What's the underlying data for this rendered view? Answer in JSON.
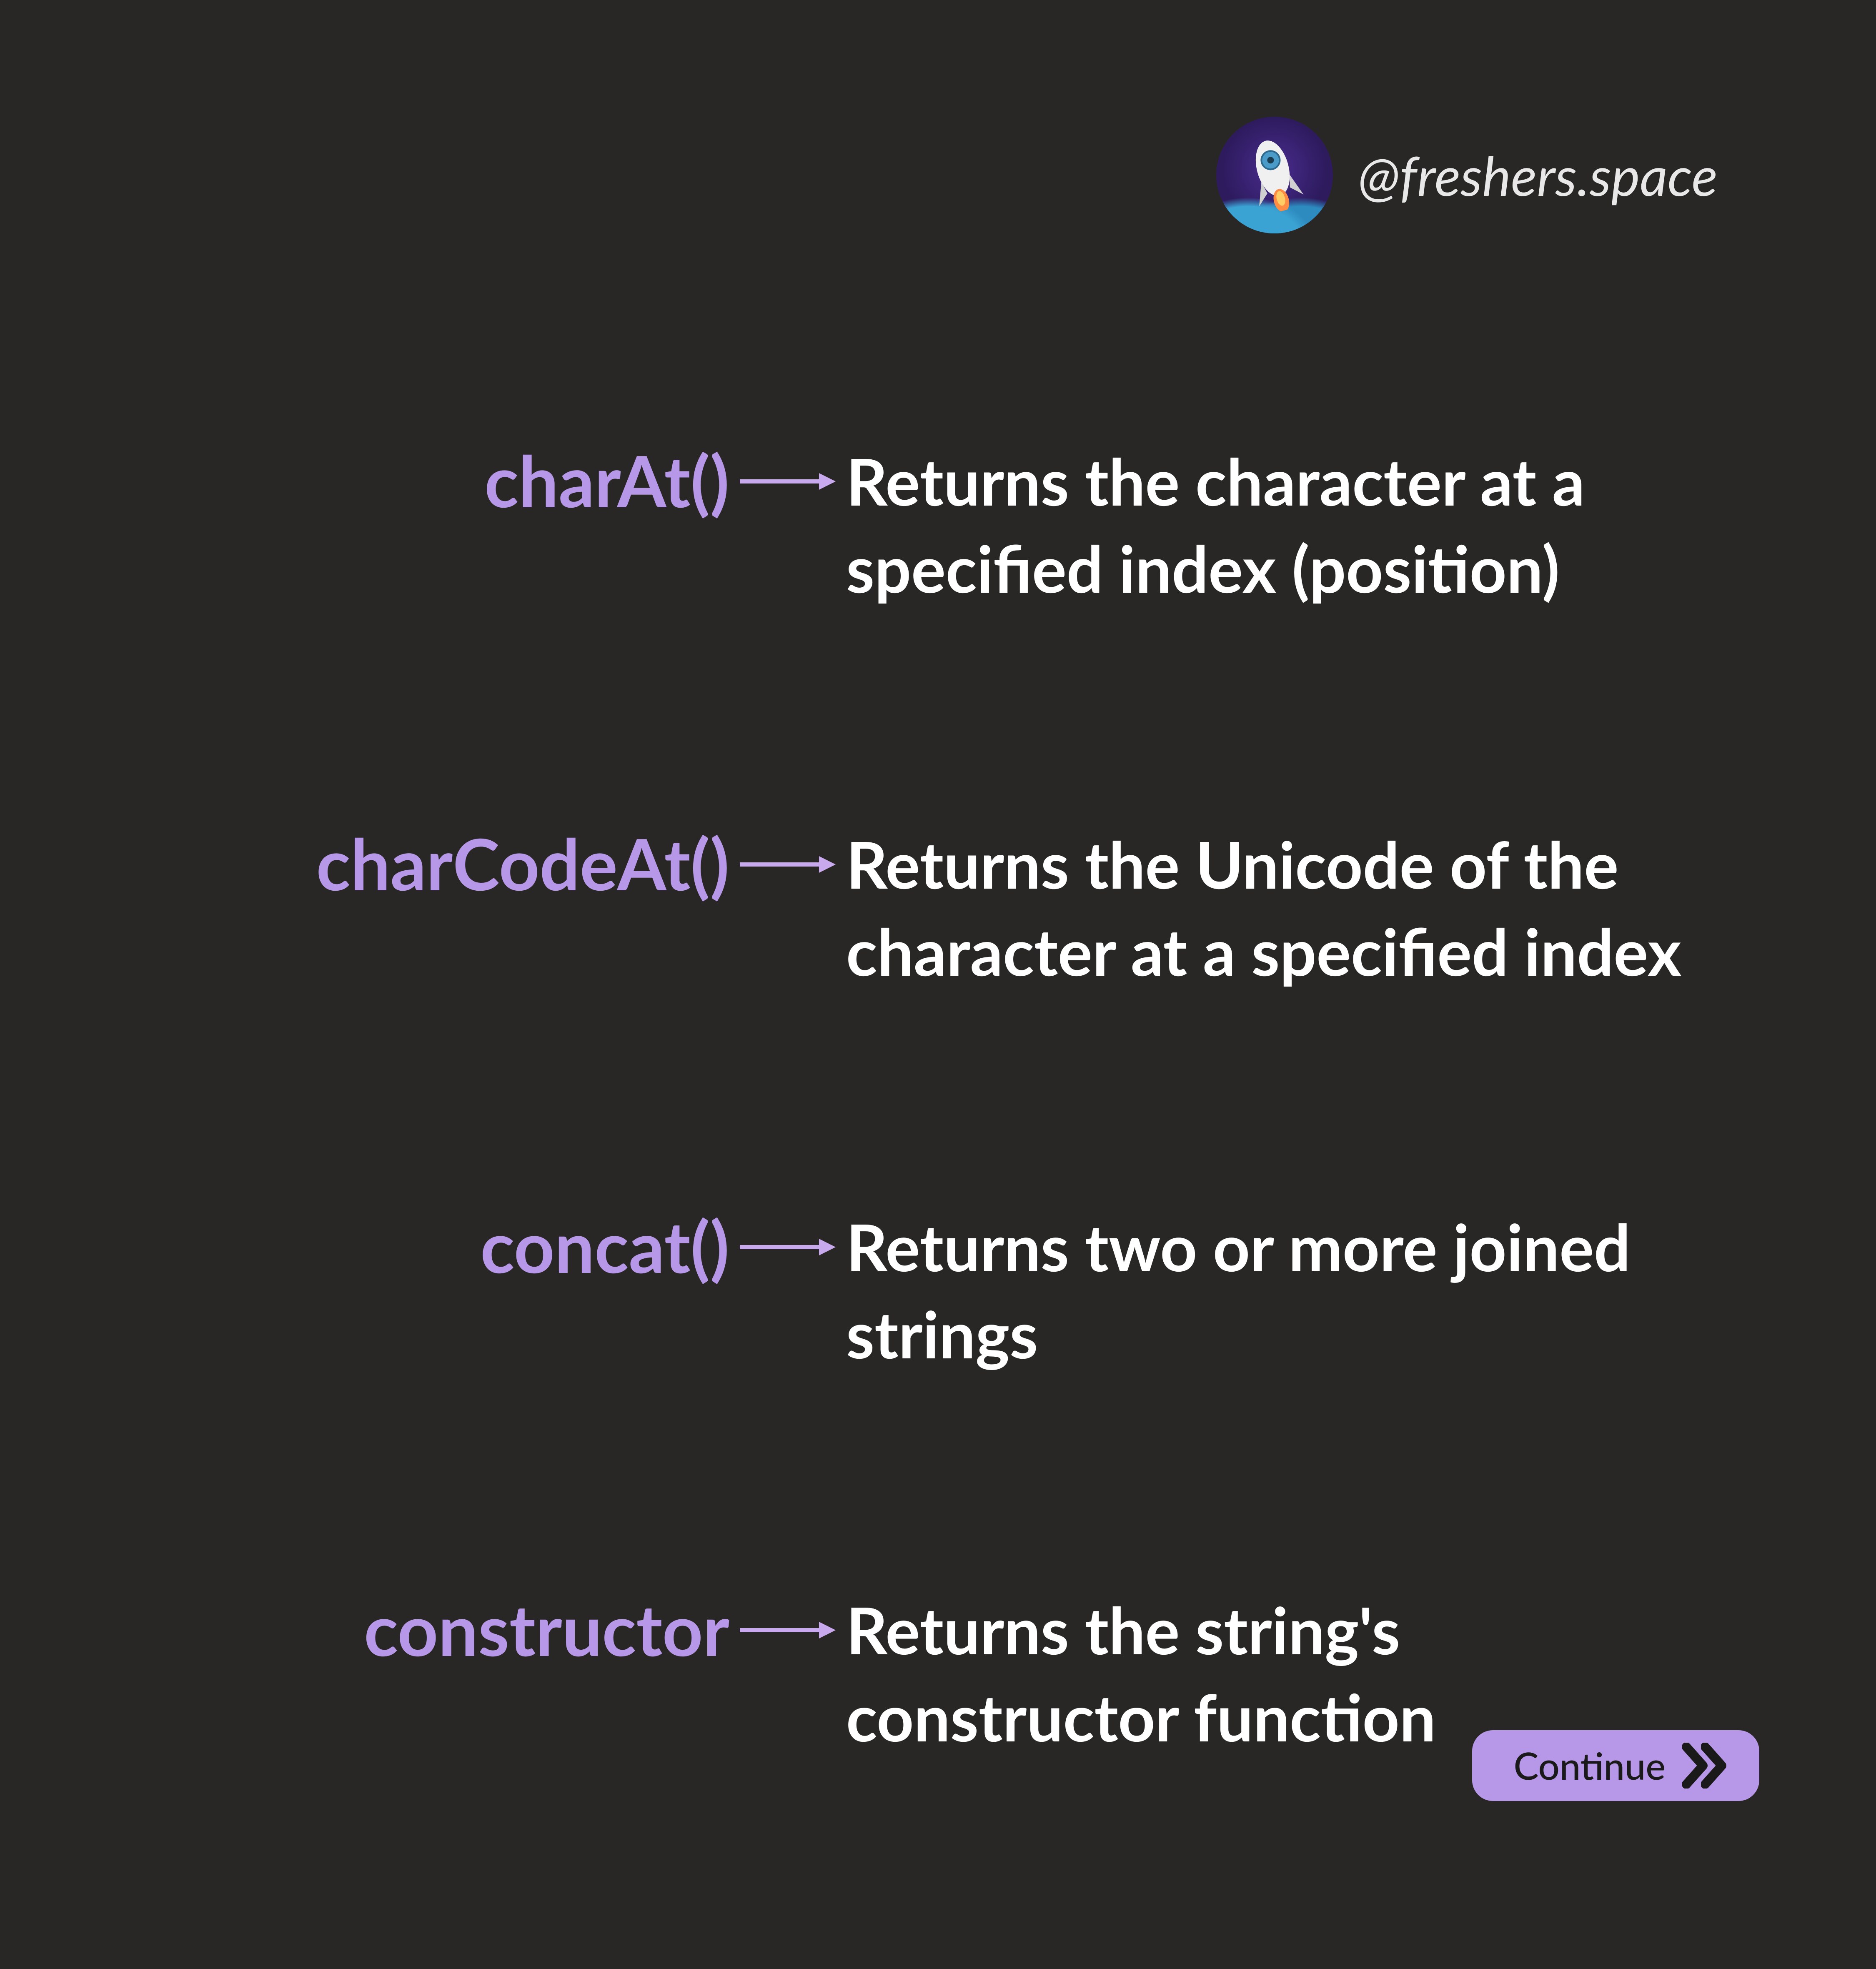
{
  "header": {
    "handle": "@freshers.space"
  },
  "methods": [
    {
      "name": "charAt()",
      "description": "Returns the character at a specified index (position)"
    },
    {
      "name": "charCodeAt()",
      "description": "Returns the Unicode of the character at a specified index"
    },
    {
      "name": "concat()",
      "description": "Returns two or more joined strings"
    },
    {
      "name": "constructor",
      "description": "Returns the string's constructor function"
    }
  ],
  "footer": {
    "continue_label": "Continue"
  },
  "colors": {
    "background": "#282725",
    "method_name": "#b798e8",
    "description": "#ffffff",
    "arrow": "#c9a9ed",
    "button_bg": "#b798e8"
  }
}
